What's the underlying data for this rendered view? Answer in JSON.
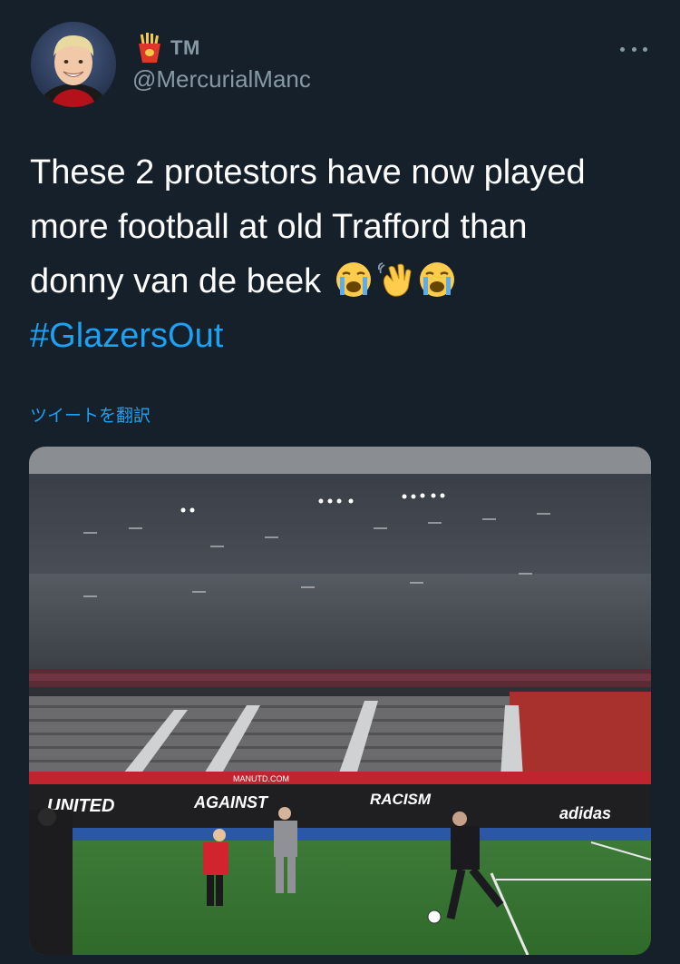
{
  "tweet": {
    "display_name": "TM",
    "handle": "@MercurialManc",
    "text_lines": [
      "These 2 protestors have now played",
      "more football at old Trafford than",
      "donny van de beek"
    ],
    "emojis": [
      "loudly-crying-face",
      "waving-hand",
      "loudly-crying-face"
    ],
    "hashtag": "#GlazersOut",
    "translate_label": "ツイートを翻訳"
  },
  "media": {
    "banner_words": [
      "UNITED",
      "AGAINST",
      "RACISM"
    ],
    "sponsor_text": "adidas",
    "stand_sign": "MANUTD.COM"
  },
  "colors": {
    "background": "#15202b",
    "text": "#ffffff",
    "secondary": "#8899a6",
    "link": "#1da1f2"
  }
}
